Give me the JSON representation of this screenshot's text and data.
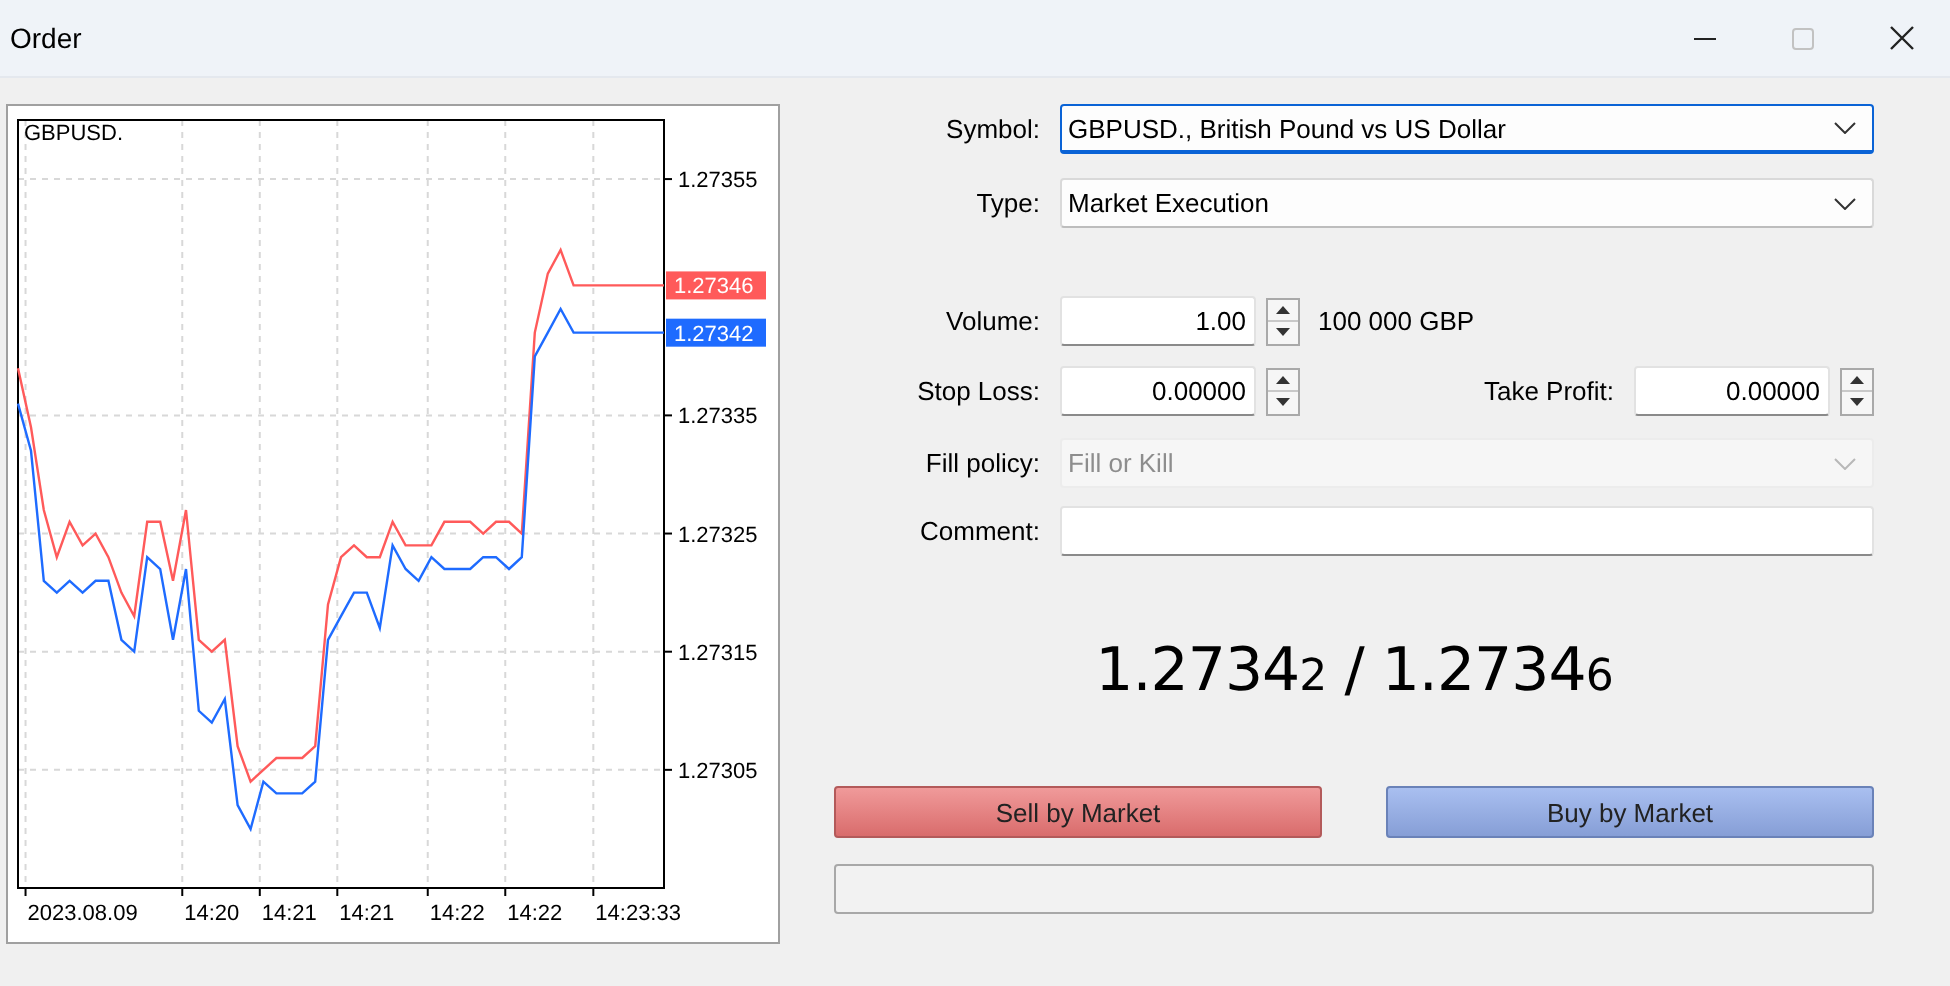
{
  "window": {
    "title": "Order",
    "buttons": [
      {
        "kind": "minimize",
        "disabled": false
      },
      {
        "kind": "maximize",
        "disabled": true
      },
      {
        "kind": "close",
        "disabled": false
      }
    ]
  },
  "chart": {
    "symbol": "GBPUSD.",
    "chart_data": {
      "type": "line",
      "categories": [
        null,
        null,
        null,
        null,
        null,
        "2023.08.09",
        null,
        null,
        null,
        null,
        null,
        null,
        null,
        null,
        null,
        "14:20",
        null,
        null,
        null,
        null,
        null,
        "14:21",
        null,
        null,
        null,
        null,
        null,
        "14:21",
        null,
        null,
        null,
        null,
        null,
        null,
        "14:22",
        null,
        null,
        null,
        null,
        null,
        "14:22",
        null,
        null,
        null,
        null,
        null,
        null,
        null,
        "14:23:33",
        null,
        null
      ],
      "series": [
        {
          "color": "#ff5a5a",
          "values": [
            1.27339,
            1.27334,
            1.27327,
            1.27323,
            1.27326,
            1.27324,
            1.27325,
            1.27323,
            1.2732,
            1.27318,
            1.27326,
            1.27326,
            1.27321,
            1.27327,
            1.27316,
            1.27315,
            1.27316,
            1.27307,
            1.27304,
            1.27305,
            1.27306,
            1.27306,
            1.27306,
            1.27307,
            1.27319,
            1.27323,
            1.27324,
            1.27323,
            1.27323,
            1.27326,
            1.27324,
            1.27324,
            1.27324,
            1.27326,
            1.27326,
            1.27326,
            1.27325,
            1.27326,
            1.27326,
            1.27325,
            1.27342,
            1.27347,
            1.27349,
            1.27346,
            1.27346,
            1.27346,
            1.27346,
            1.27346,
            1.27346,
            1.27346,
            1.27346
          ]
        },
        {
          "color": "#1e6bff",
          "values": [
            1.27336,
            1.27332,
            1.27321,
            1.2732,
            1.27321,
            1.2732,
            1.27321,
            1.27321,
            1.27316,
            1.27315,
            1.27323,
            1.27322,
            1.27316,
            1.27322,
            1.2731,
            1.27309,
            1.27311,
            1.27302,
            1.273,
            1.27304,
            1.27303,
            1.27303,
            1.27303,
            1.27304,
            1.27316,
            1.27318,
            1.2732,
            1.2732,
            1.27317,
            1.27324,
            1.27322,
            1.27321,
            1.27323,
            1.27322,
            1.27322,
            1.27322,
            1.27323,
            1.27323,
            1.27322,
            1.27323,
            1.2734,
            1.27342,
            1.27344,
            1.27342,
            1.27342,
            1.27342,
            1.27342,
            1.27342,
            1.27342,
            1.27342,
            1.27342
          ]
        }
      ],
      "grid": true,
      "ylim": [
        1.27295,
        1.2736
      ],
      "yticks": [
        {
          "value": 1.27355,
          "label": "1.27355"
        },
        {
          "value": 1.27335,
          "label": "1.27335"
        },
        {
          "value": 1.27325,
          "label": "1.27325"
        },
        {
          "value": 1.27315,
          "label": "1.27315"
        },
        {
          "value": 1.27305,
          "label": "1.27305"
        }
      ],
      "annotations": [
        "1.27346",
        "1.27342"
      ]
    }
  },
  "form": {
    "symbol": {
      "label": "Symbol:",
      "value": "GBPUSD., British Pound vs US Dollar",
      "focused": true
    },
    "type": {
      "label": "Type:",
      "value": "Market Execution"
    },
    "volume": {
      "label": "Volume:",
      "value": "1.00",
      "unit": "100 000 GBP"
    },
    "stop_loss": {
      "label": "Stop Loss:",
      "value": "0.00000"
    },
    "take_profit": {
      "label": "Take Profit:",
      "value": "0.00000"
    },
    "fill_policy": {
      "label": "Fill policy:",
      "value": "Fill or Kill",
      "disabled": true
    },
    "comment": {
      "label": "Comment:"
    }
  },
  "prices": "1.2734$_{2}$ / 1.2734$_{6}$",
  "buttons": [
    {
      "label": "Sell by Market",
      "kind": "sell"
    },
    {
      "label": "Buy by Market",
      "kind": "buy"
    }
  ]
}
